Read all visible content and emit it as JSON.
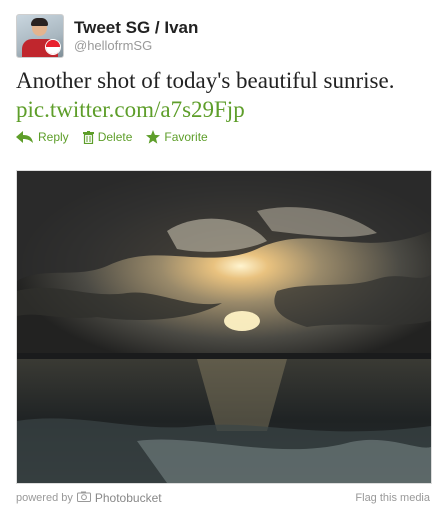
{
  "user": {
    "display_name": "Tweet SG / Ivan",
    "handle": "@hellofrmSG"
  },
  "tweet": {
    "text": "Another shot of today's beautiful sunrise.",
    "link": "pic.twitter.com/a7s29Fjp"
  },
  "actions": {
    "reply": "Reply",
    "delete": "Delete",
    "favorite": "Favorite"
  },
  "footer": {
    "powered_by": "powered by",
    "provider": "Photobucket",
    "flag": "Flag this media"
  },
  "colors": {
    "link": "#5e9e2a",
    "muted": "#999999"
  }
}
